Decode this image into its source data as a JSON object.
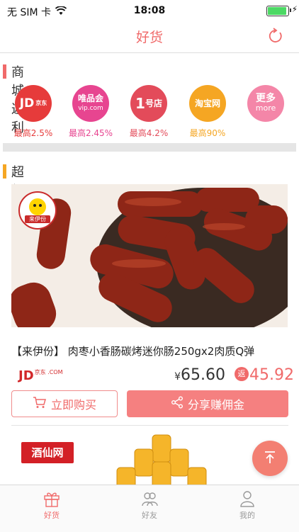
{
  "status_bar": {
    "carrier": "无 SIM 卡",
    "time": "18:08"
  },
  "nav": {
    "title": "好货",
    "refresh_icon": "refresh-icon"
  },
  "mall_section": {
    "title": "商城返利",
    "accent_color": "#f06a6a",
    "malls": [
      {
        "logo_text": "JD京东",
        "rate": "最高2.5%",
        "color": "#e63b3b"
      },
      {
        "logo_text": "唯品会 vip.com",
        "rate": "最高2.45%",
        "color": "#e74590"
      },
      {
        "logo_text": "1号店",
        "rate": "最高4.2%",
        "color": "#e34b5a"
      },
      {
        "logo_text": "淘宝网",
        "rate": "最高90%",
        "color": "#f5a623"
      },
      {
        "logo_text": "更多 more",
        "rate": "",
        "color": "#f486a8"
      }
    ]
  },
  "super_section": {
    "title": "超级返",
    "accent_color": "#f5a623"
  },
  "product": {
    "brand_badge": "来伊份",
    "title": "【来伊份】 肉枣小香肠碳烤迷你肠250gx2肉质Q弹",
    "store": "JD",
    "store_sub": "京东 .COM",
    "price_symbol": "¥",
    "price": "65.60",
    "rebate_label": "返",
    "rebate": "45.92",
    "buy_label": "立即购买",
    "share_label": "分享赚佣金"
  },
  "next_product": {
    "brand": "酒仙网"
  },
  "tabbar": {
    "tabs": [
      {
        "label": "好货",
        "icon": "gift-icon",
        "active": true
      },
      {
        "label": "好友",
        "icon": "friends-icon",
        "active": false
      },
      {
        "label": "我的",
        "icon": "user-icon",
        "active": false
      }
    ]
  }
}
